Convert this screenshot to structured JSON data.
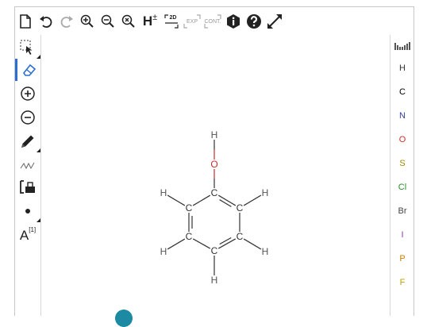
{
  "top_toolbar": {
    "h_label": "H",
    "h_sign": "±",
    "twod_label": "2D",
    "exp_label": "EXP",
    "cont_label": "CONT."
  },
  "left_toolbar": {
    "atom_label": "A",
    "atom_index": "[1]"
  },
  "elements": [
    {
      "symbol": "H",
      "color": "#333333"
    },
    {
      "symbol": "C",
      "color": "#000000"
    },
    {
      "symbol": "N",
      "color": "#2e3f9e"
    },
    {
      "symbol": "O",
      "color": "#d22c2c"
    },
    {
      "symbol": "S",
      "color": "#9a8c00"
    },
    {
      "symbol": "Cl",
      "color": "#208f20"
    },
    {
      "symbol": "Br",
      "color": "#444444"
    },
    {
      "symbol": "I",
      "color": "#8a3a9a"
    },
    {
      "symbol": "P",
      "color": "#c67f00"
    },
    {
      "symbol": "F",
      "color": "#b8a000"
    }
  ],
  "molecule": {
    "atoms": [
      "H",
      "O",
      "C",
      "C",
      "C",
      "C",
      "C",
      "C",
      "H",
      "H",
      "H",
      "H",
      "H"
    ],
    "colors": {
      "oxygen": "#cc2a2a",
      "atom": "#333333",
      "hydrogen": "#555555"
    }
  }
}
